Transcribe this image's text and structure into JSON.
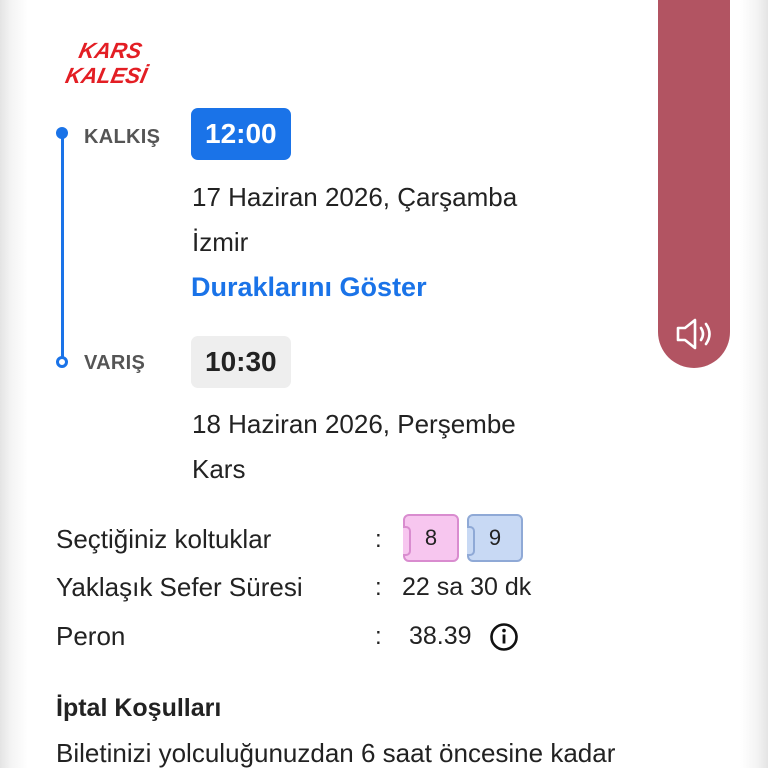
{
  "brand": {
    "logo_text_line1": "KARS",
    "logo_text_line2": "KALESİ",
    "color": "#e31e24"
  },
  "departure": {
    "label": "KALKIŞ",
    "time": "12:00",
    "date": "17 Haziran 2026, Çarşamba",
    "city": "İzmir",
    "stops_link": "Duraklarını Göster"
  },
  "arrival": {
    "label": "VARIŞ",
    "time": "10:30",
    "date": "18 Haziran 2026, Perşembe",
    "city": "Kars"
  },
  "details": {
    "seats": {
      "label": "Seçtiğiniz koltuklar",
      "colon": ":",
      "items": [
        "8",
        "9"
      ]
    },
    "duration": {
      "label": "Yaklaşık Sefer Süresi",
      "colon": ":",
      "value": "22 sa 30 dk"
    },
    "platform": {
      "label": "Peron",
      "colon": ":",
      "value": "38.39"
    }
  },
  "cancellation": {
    "title": "İptal Koşulları",
    "text": "Biletinizi yolculuğunuzdan 6 saat öncesine kadar"
  },
  "icons": {
    "sound": "speaker-icon",
    "info": "info-icon"
  },
  "colors": {
    "accent": "#1a73e8",
    "sound_tab": "#b25462",
    "seat_female": "#f7c6ef",
    "seat_male": "#c8d9f4"
  }
}
